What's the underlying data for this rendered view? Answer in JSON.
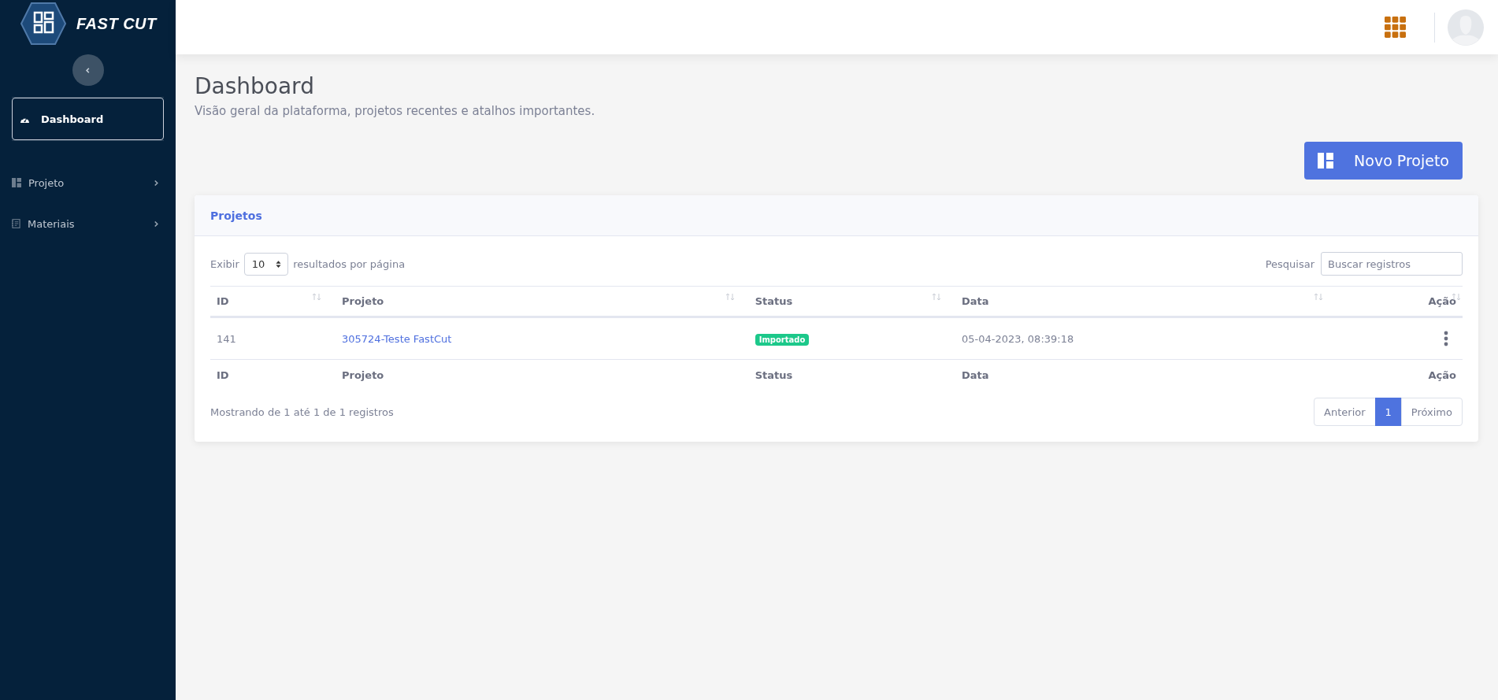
{
  "brand": {
    "name": "FAST CUT"
  },
  "sidebar": {
    "items": [
      {
        "label": "Dashboard",
        "kind": "link",
        "selected": true
      },
      {
        "label": "Projeto",
        "kind": "menu",
        "selected": false,
        "expanded": false
      },
      {
        "label": "Materiais",
        "kind": "menu",
        "selected": false,
        "expanded": false
      }
    ]
  },
  "page": {
    "title": "Dashboard",
    "subtitle": "Visão geral da plataforma, projetos recentes e atalhos importantes."
  },
  "new_button": {
    "label": "Novo Projeto"
  },
  "card": {
    "title": "Projetos",
    "length": {
      "prefix": "Exibir",
      "value": "10",
      "suffix": "resultados por página"
    },
    "search": {
      "label": "Pesquisar",
      "placeholder": "Buscar registros"
    },
    "table": {
      "columns": [
        {
          "label": "ID",
          "sortable": true
        },
        {
          "label": "Projeto",
          "sortable": true
        },
        {
          "label": "Status",
          "sortable": true
        },
        {
          "label": "Data",
          "sortable": true
        },
        {
          "label": "Ação",
          "sortable": true
        }
      ],
      "rows": [
        {
          "id": "141",
          "project": "305724-Teste FastCut",
          "status": "Importado",
          "date": "05-04-2023, 08:39:18"
        }
      ],
      "footer": [
        "ID",
        "Projeto",
        "Status",
        "Data",
        "Ação"
      ]
    },
    "info": "Mostrando de 1 até 1 de 1 registros",
    "pagination": [
      {
        "label": "Anterior",
        "selected": false
      },
      {
        "label": "1",
        "selected": true
      },
      {
        "label": "Próximo",
        "selected": false
      }
    ]
  }
}
